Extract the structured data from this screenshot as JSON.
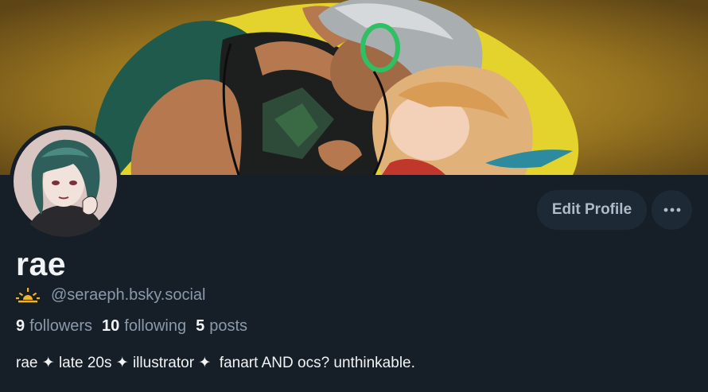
{
  "profile": {
    "display_name": "rae",
    "handle": "@seraeph.bsky.social",
    "handle_icon": "sunrise-icon",
    "bio": "rae ✦ late 20s ✦ illustrator ✦  fanart AND ocs? unthinkable.",
    "stats": {
      "followers_count": "9",
      "followers_label": "followers",
      "following_count": "10",
      "following_label": "following",
      "posts_count": "5",
      "posts_label": "posts"
    }
  },
  "actions": {
    "edit_profile_label": "Edit Profile",
    "more_icon": "ellipsis-icon"
  },
  "colors": {
    "background": "#161e27",
    "button_bg": "#1e2936",
    "muted_text": "#8a9aab",
    "primary_text": "#f1f3f5",
    "sun_icon": "#f0b429",
    "banner_glow": "#e8d22a"
  }
}
